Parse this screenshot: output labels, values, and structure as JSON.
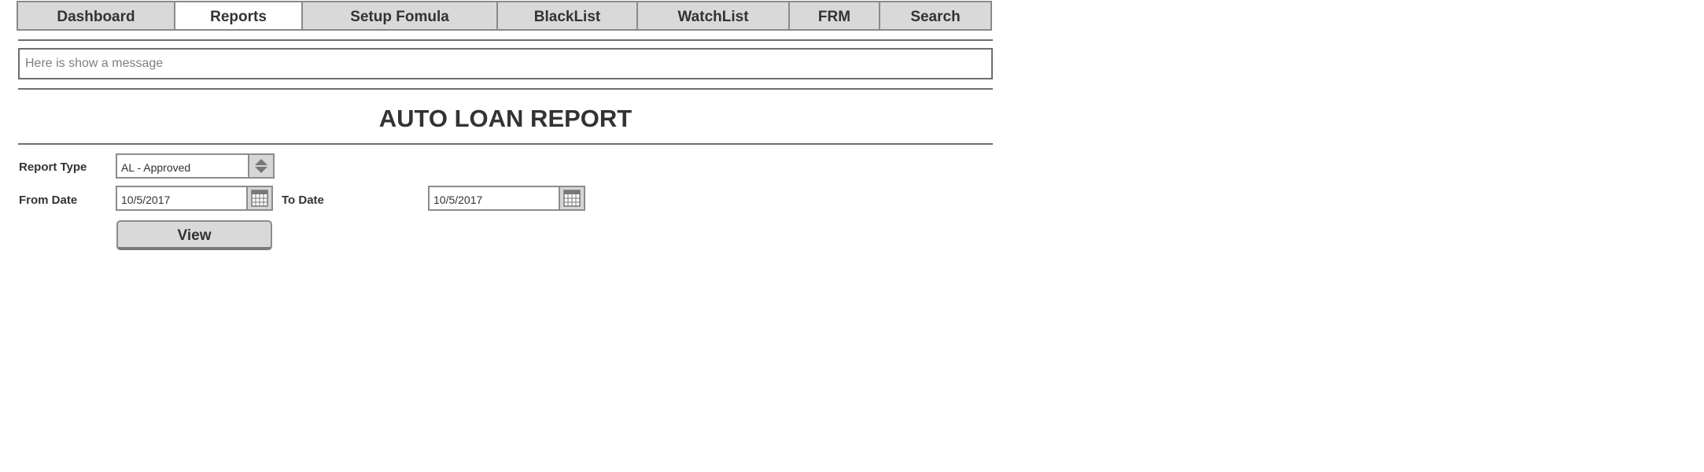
{
  "nav": {
    "tabs": [
      {
        "label": "Dashboard",
        "active": false
      },
      {
        "label": "Reports",
        "active": true
      },
      {
        "label": "Setup Fomula",
        "active": false
      },
      {
        "label": "BlackList",
        "active": false
      },
      {
        "label": "WatchList",
        "active": false
      },
      {
        "label": "FRM",
        "active": false
      },
      {
        "label": "Search",
        "active": false
      }
    ]
  },
  "message": {
    "text": "Here is show a message"
  },
  "page": {
    "title": "AUTO LOAN REPORT"
  },
  "form": {
    "report_type_label": "Report Type",
    "report_type_value": "AL - Approved",
    "from_date_label": "From Date",
    "from_date_value": "10/5/2017",
    "to_date_label": "To Date",
    "to_date_value": "10/5/2017",
    "view_label": "View"
  },
  "icons": {
    "stepper": "up-down-stepper-icon",
    "calendar": "calendar-icon"
  },
  "colors": {
    "tab_bg": "#d9d9d9",
    "active_tab_bg": "#ffffff",
    "border": "#8a8a8a",
    "text": "#333333"
  }
}
